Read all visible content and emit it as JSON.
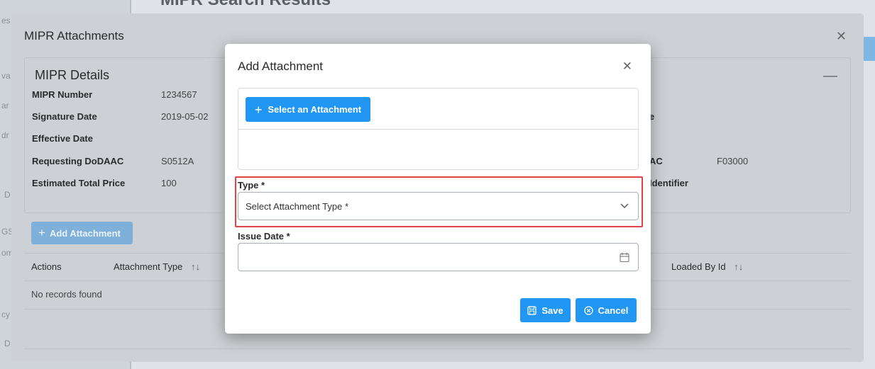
{
  "background": {
    "title": "MIPR Search Results",
    "fragments": [
      "es",
      "va",
      "ar",
      "dr",
      "D",
      "GS",
      "om",
      "cy",
      "D"
    ]
  },
  "outer_dialog": {
    "title": "MIPR Attachments",
    "details": {
      "heading": "MIPR Details",
      "left_fields": [
        {
          "label": "MIPR Number",
          "value": "1234567"
        },
        {
          "label": "Signature Date",
          "value": "2019-05-02"
        },
        {
          "label": "Effective Date",
          "value": ""
        },
        {
          "label": "Requesting DoDAAC",
          "value": "S0512A"
        },
        {
          "label": "Estimated Total Price",
          "value": "100"
        }
      ],
      "right_fields": [
        {
          "label": "e",
          "value": ""
        },
        {
          "label": "AC",
          "value": "F03000"
        },
        {
          "label": "Identifier",
          "value": ""
        }
      ]
    },
    "add_attachment_label": "Add Attachment",
    "table": {
      "columns": [
        "Actions",
        "Attachment Type",
        "Loaded By Id"
      ],
      "empty_text": "No records found"
    }
  },
  "modal": {
    "title": "Add Attachment",
    "select_attachment_label": "Select an Attachment",
    "type_label": "Type *",
    "type_placeholder": "Select Attachment Type *",
    "issue_date_label": "Issue Date *",
    "issue_date_value": "",
    "save_label": "Save",
    "cancel_label": "Cancel"
  },
  "colors": {
    "primary": "#2196f3",
    "highlight": "#e04545"
  }
}
